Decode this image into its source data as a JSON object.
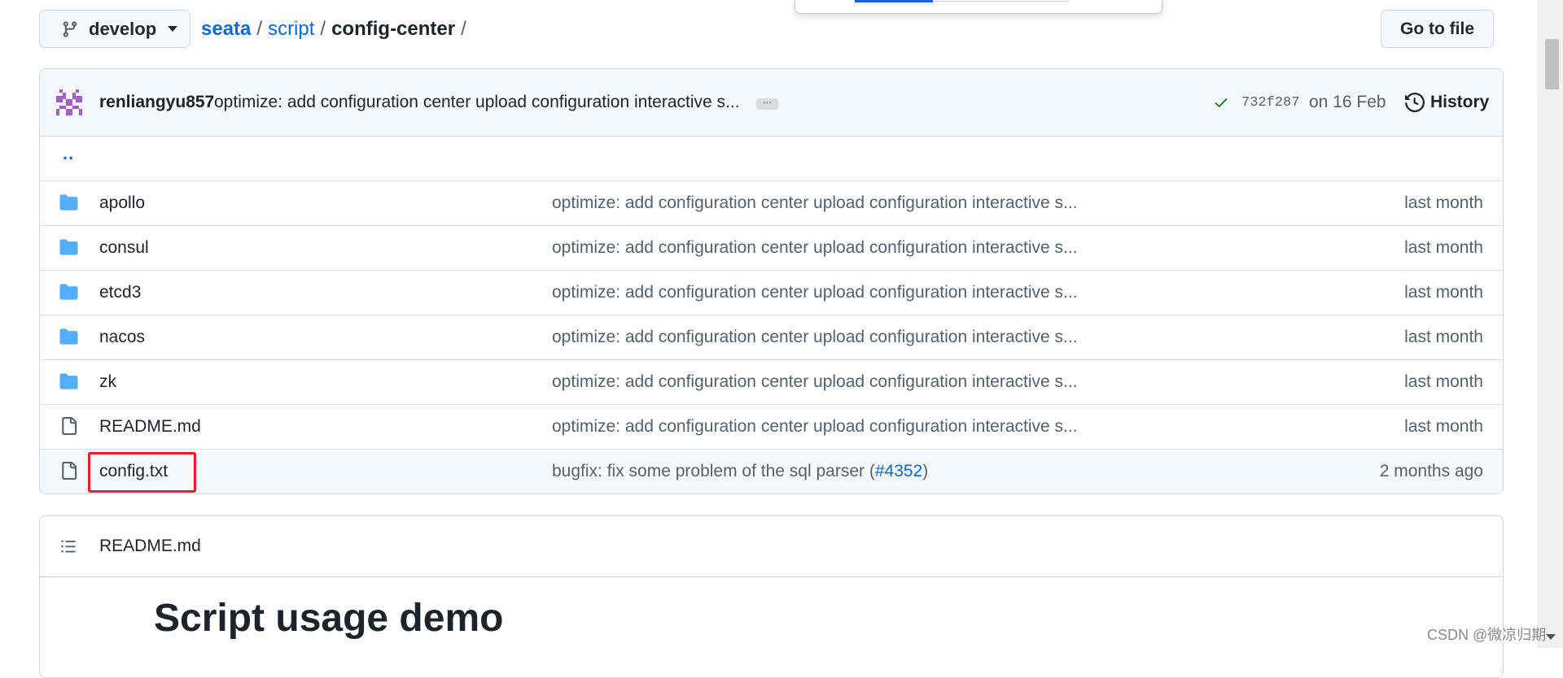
{
  "branch": {
    "name": "develop"
  },
  "breadcrumb": {
    "repo": "seata",
    "sep1": "/",
    "folder": "script",
    "sep2": "/",
    "current": "config-center",
    "sep3": "/"
  },
  "go_to_file": "Go to file",
  "commit": {
    "author": "renliangyu857",
    "message": "optimize: add configuration center upload configuration interactive s...",
    "ellipsis": "…",
    "sha": "732f287",
    "date": "on 16 Feb",
    "history": "History"
  },
  "up_dir": "..",
  "files": [
    {
      "type": "dir",
      "name": "apollo",
      "message": "optimize: add configuration center upload configuration interactive s...",
      "time": "last month"
    },
    {
      "type": "dir",
      "name": "consul",
      "message": "optimize: add configuration center upload configuration interactive s...",
      "time": "last month"
    },
    {
      "type": "dir",
      "name": "etcd3",
      "message": "optimize: add configuration center upload configuration interactive s...",
      "time": "last month"
    },
    {
      "type": "dir",
      "name": "nacos",
      "message": "optimize: add configuration center upload configuration interactive s...",
      "time": "last month"
    },
    {
      "type": "dir",
      "name": "zk",
      "message": "optimize: add configuration center upload configuration interactive s...",
      "time": "last month"
    },
    {
      "type": "file",
      "name": "README.md",
      "message": "optimize: add configuration center upload configuration interactive s...",
      "time": "last month"
    },
    {
      "type": "file",
      "name": "config.txt",
      "message": "bugfix: fix some problem of the sql parser (",
      "link": "#4352",
      "message_end": ")",
      "time": "2 months ago"
    }
  ],
  "readme": {
    "filename": "README.md",
    "heading": "Script usage demo"
  },
  "watermark": "CSDN @微凉归期",
  "colors": {
    "link": "#0969da",
    "folder": "#54aeff",
    "check": "#1a7f37",
    "highlight": "#e3211c"
  }
}
